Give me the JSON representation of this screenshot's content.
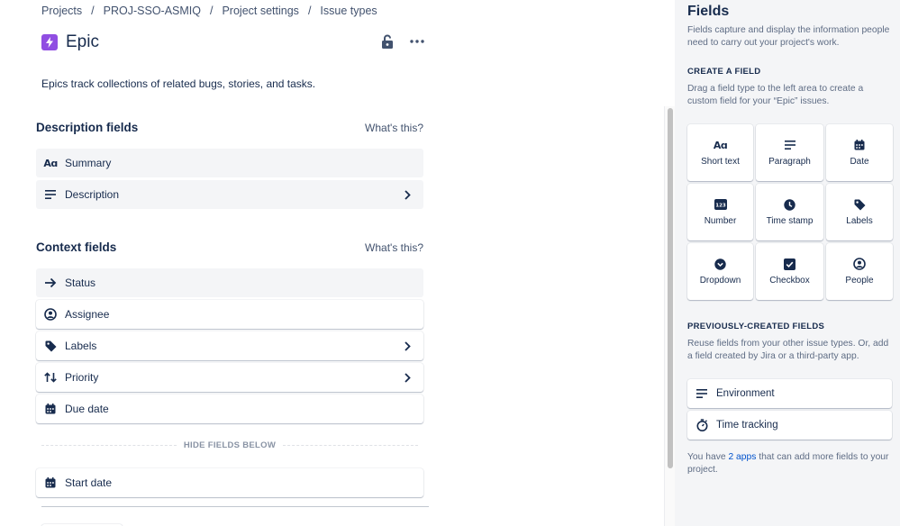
{
  "breadcrumb": {
    "items": [
      "Projects",
      "PROJ-SSO-ASMIQ",
      "Project settings",
      "Issue types"
    ],
    "separator": "/"
  },
  "issue_type": {
    "title": "Epic",
    "description": "Epics track collections of related bugs, stories, and tasks.",
    "badge_color": "#904ee2"
  },
  "description_section": {
    "title": "Description fields",
    "help": "What's this?",
    "fields": [
      {
        "label": "Summary",
        "icon": "short-text-icon"
      },
      {
        "label": "Description",
        "icon": "paragraph-icon",
        "expandable": true
      }
    ]
  },
  "context_section": {
    "title": "Context fields",
    "help": "What's this?",
    "fields": [
      {
        "label": "Status",
        "icon": "arrow-right-icon"
      },
      {
        "label": "Assignee",
        "icon": "person-icon"
      },
      {
        "label": "Labels",
        "icon": "tag-icon",
        "expandable": true
      },
      {
        "label": "Priority",
        "icon": "priority-icon",
        "expandable": true
      },
      {
        "label": "Due date",
        "icon": "calendar-icon"
      }
    ],
    "divider": "HIDE FIELDS BELOW",
    "hidden_fields": [
      {
        "label": "Start date",
        "icon": "calendar-icon"
      }
    ]
  },
  "panel": {
    "title": "Fields",
    "intro": "Fields capture and display the information people need to carry out your project's work.",
    "create_heading": "CREATE A FIELD",
    "create_help": "Drag a field type to the left area to create a custom field for your “Epic” issues.",
    "field_types": [
      {
        "label": "Short text",
        "icon": "short-text-icon"
      },
      {
        "label": "Paragraph",
        "icon": "paragraph-icon"
      },
      {
        "label": "Date",
        "icon": "calendar-icon"
      },
      {
        "label": "Number",
        "icon": "number-icon"
      },
      {
        "label": "Time stamp",
        "icon": "clock-icon"
      },
      {
        "label": "Labels",
        "icon": "tag-icon"
      },
      {
        "label": "Dropdown",
        "icon": "dropdown-icon"
      },
      {
        "label": "Checkbox",
        "icon": "checkbox-icon"
      },
      {
        "label": "People",
        "icon": "person-icon"
      }
    ],
    "previous_heading": "PREVIOUSLY-CREATED FIELDS",
    "previous_help": "Reuse fields from your other issue types. Or, add a field created by Jira or a third-party app.",
    "previous_fields": [
      {
        "label": "Environment",
        "icon": "paragraph-icon"
      },
      {
        "label": "Time tracking",
        "icon": "stopwatch-icon"
      }
    ],
    "apps_prefix": "You have ",
    "apps_link": "2 apps",
    "apps_suffix": " that can add more fields to your project."
  },
  "icons": {
    "short_text_glyph": "Aɑ",
    "number_glyph": "123"
  },
  "colors": {
    "text": "#172b4d",
    "subtle": "#5e6c84",
    "link": "#0052cc",
    "panel_bg": "#f4f5f7"
  }
}
